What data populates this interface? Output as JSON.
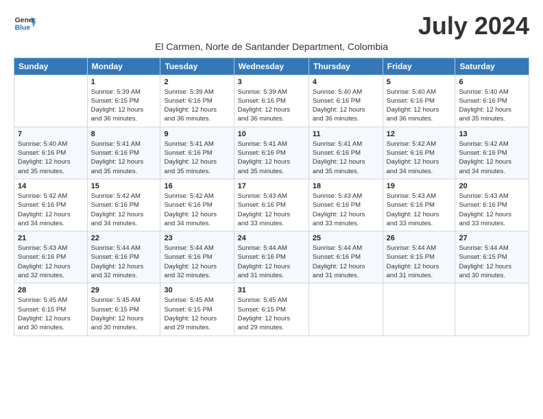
{
  "header": {
    "logo_general": "General",
    "logo_blue": "Blue",
    "month_title": "July 2024",
    "location": "El Carmen, Norte de Santander Department, Colombia"
  },
  "days_of_week": [
    "Sunday",
    "Monday",
    "Tuesday",
    "Wednesday",
    "Thursday",
    "Friday",
    "Saturday"
  ],
  "weeks": [
    [
      {
        "day": "",
        "info": ""
      },
      {
        "day": "1",
        "info": "Sunrise: 5:39 AM\nSunset: 6:15 PM\nDaylight: 12 hours\nand 36 minutes."
      },
      {
        "day": "2",
        "info": "Sunrise: 5:39 AM\nSunset: 6:16 PM\nDaylight: 12 hours\nand 36 minutes."
      },
      {
        "day": "3",
        "info": "Sunrise: 5:39 AM\nSunset: 6:16 PM\nDaylight: 12 hours\nand 36 minutes."
      },
      {
        "day": "4",
        "info": "Sunrise: 5:40 AM\nSunset: 6:16 PM\nDaylight: 12 hours\nand 36 minutes."
      },
      {
        "day": "5",
        "info": "Sunrise: 5:40 AM\nSunset: 6:16 PM\nDaylight: 12 hours\nand 36 minutes."
      },
      {
        "day": "6",
        "info": "Sunrise: 5:40 AM\nSunset: 6:16 PM\nDaylight: 12 hours\nand 35 minutes."
      }
    ],
    [
      {
        "day": "7",
        "info": "Sunrise: 5:40 AM\nSunset: 6:16 PM\nDaylight: 12 hours\nand 35 minutes."
      },
      {
        "day": "8",
        "info": "Sunrise: 5:41 AM\nSunset: 6:16 PM\nDaylight: 12 hours\nand 35 minutes."
      },
      {
        "day": "9",
        "info": "Sunrise: 5:41 AM\nSunset: 6:16 PM\nDaylight: 12 hours\nand 35 minutes."
      },
      {
        "day": "10",
        "info": "Sunrise: 5:41 AM\nSunset: 6:16 PM\nDaylight: 12 hours\nand 35 minutes."
      },
      {
        "day": "11",
        "info": "Sunrise: 5:41 AM\nSunset: 6:16 PM\nDaylight: 12 hours\nand 35 minutes."
      },
      {
        "day": "12",
        "info": "Sunrise: 5:42 AM\nSunset: 6:16 PM\nDaylight: 12 hours\nand 34 minutes."
      },
      {
        "day": "13",
        "info": "Sunrise: 5:42 AM\nSunset: 6:16 PM\nDaylight: 12 hours\nand 34 minutes."
      }
    ],
    [
      {
        "day": "14",
        "info": "Sunrise: 5:42 AM\nSunset: 6:16 PM\nDaylight: 12 hours\nand 34 minutes."
      },
      {
        "day": "15",
        "info": "Sunrise: 5:42 AM\nSunset: 6:16 PM\nDaylight: 12 hours\nand 34 minutes."
      },
      {
        "day": "16",
        "info": "Sunrise: 5:42 AM\nSunset: 6:16 PM\nDaylight: 12 hours\nand 34 minutes."
      },
      {
        "day": "17",
        "info": "Sunrise: 5:43 AM\nSunset: 6:16 PM\nDaylight: 12 hours\nand 33 minutes."
      },
      {
        "day": "18",
        "info": "Sunrise: 5:43 AM\nSunset: 6:16 PM\nDaylight: 12 hours\nand 33 minutes."
      },
      {
        "day": "19",
        "info": "Sunrise: 5:43 AM\nSunset: 6:16 PM\nDaylight: 12 hours\nand 33 minutes."
      },
      {
        "day": "20",
        "info": "Sunrise: 5:43 AM\nSunset: 6:16 PM\nDaylight: 12 hours\nand 33 minutes."
      }
    ],
    [
      {
        "day": "21",
        "info": "Sunrise: 5:43 AM\nSunset: 6:16 PM\nDaylight: 12 hours\nand 32 minutes."
      },
      {
        "day": "22",
        "info": "Sunrise: 5:44 AM\nSunset: 6:16 PM\nDaylight: 12 hours\nand 32 minutes."
      },
      {
        "day": "23",
        "info": "Sunrise: 5:44 AM\nSunset: 6:16 PM\nDaylight: 12 hours\nand 32 minutes."
      },
      {
        "day": "24",
        "info": "Sunrise: 5:44 AM\nSunset: 6:16 PM\nDaylight: 12 hours\nand 31 minutes."
      },
      {
        "day": "25",
        "info": "Sunrise: 5:44 AM\nSunset: 6:16 PM\nDaylight: 12 hours\nand 31 minutes."
      },
      {
        "day": "26",
        "info": "Sunrise: 5:44 AM\nSunset: 6:15 PM\nDaylight: 12 hours\nand 31 minutes."
      },
      {
        "day": "27",
        "info": "Sunrise: 5:44 AM\nSunset: 6:15 PM\nDaylight: 12 hours\nand 30 minutes."
      }
    ],
    [
      {
        "day": "28",
        "info": "Sunrise: 5:45 AM\nSunset: 6:15 PM\nDaylight: 12 hours\nand 30 minutes."
      },
      {
        "day": "29",
        "info": "Sunrise: 5:45 AM\nSunset: 6:15 PM\nDaylight: 12 hours\nand 30 minutes."
      },
      {
        "day": "30",
        "info": "Sunrise: 5:45 AM\nSunset: 6:15 PM\nDaylight: 12 hours\nand 29 minutes."
      },
      {
        "day": "31",
        "info": "Sunrise: 5:45 AM\nSunset: 6:15 PM\nDaylight: 12 hours\nand 29 minutes."
      },
      {
        "day": "",
        "info": ""
      },
      {
        "day": "",
        "info": ""
      },
      {
        "day": "",
        "info": ""
      }
    ]
  ]
}
